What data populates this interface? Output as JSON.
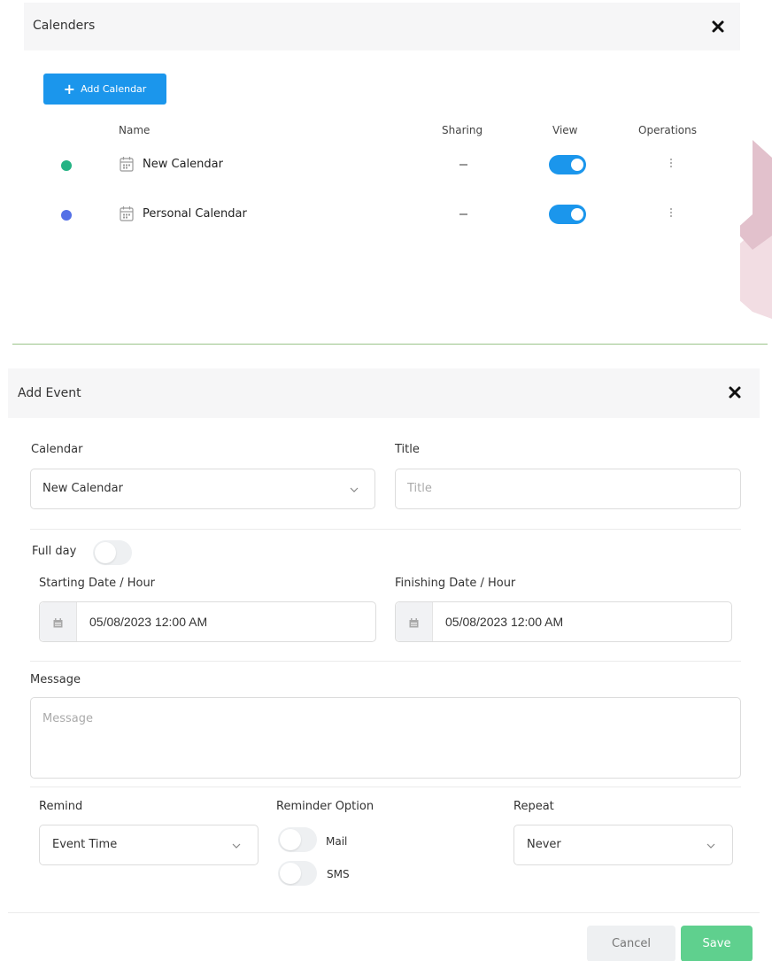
{
  "calendars_panel": {
    "title": "Calenders",
    "add_button_label": "Add Calendar",
    "columns": {
      "name": "Name",
      "sharing": "Sharing",
      "view": "View",
      "operations": "Operations"
    },
    "rows": [
      {
        "name": "New Calendar",
        "color": "#25b384",
        "sharing": "—",
        "view_enabled": true
      },
      {
        "name": "Personal Calendar",
        "color": "#5470e6",
        "sharing": "—",
        "view_enabled": true
      }
    ]
  },
  "add_event": {
    "title": "Add Event",
    "calendar": {
      "label": "Calendar",
      "value": "New Calendar"
    },
    "title_field": {
      "label": "Title",
      "placeholder": "Title"
    },
    "full_day": {
      "label": "Full day",
      "enabled": false
    },
    "start": {
      "label": "Starting Date / Hour",
      "value": "05/08/2023 12:00 AM"
    },
    "finish": {
      "label": "Finishing Date / Hour",
      "value": "05/08/2023 12:00 AM"
    },
    "message": {
      "label": "Message",
      "placeholder": "Message"
    },
    "remind": {
      "label": "Remind",
      "value": "Event Time"
    },
    "reminder_option": {
      "label": "Reminder Option",
      "mail_label": "Mail",
      "sms_label": "SMS",
      "mail_enabled": false,
      "sms_enabled": false
    },
    "repeat": {
      "label": "Repeat",
      "value": "Never"
    },
    "cancel_label": "Cancel",
    "save_label": "Save"
  },
  "colors": {
    "primary": "#1b96ec",
    "save": "#5fd08e",
    "cancel_bg": "#eef0f2"
  }
}
